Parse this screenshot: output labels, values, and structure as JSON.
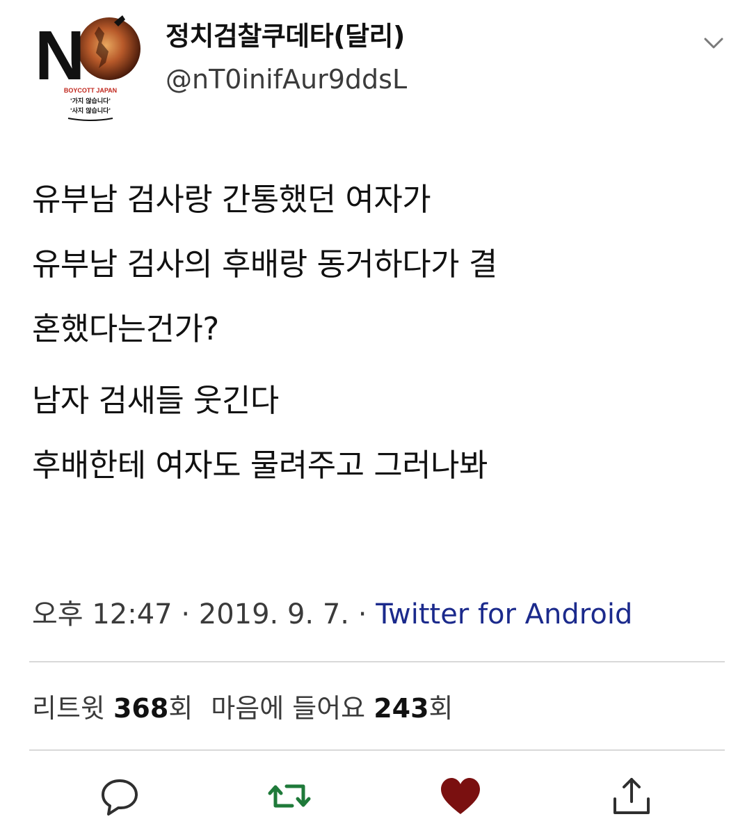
{
  "tweet": {
    "author": {
      "display_name": "정치검찰쿠데타(달리)",
      "handle": "@nT0inifAur9ddsL",
      "avatar": {
        "big_text": "N",
        "caption_line1": "BOYCOTT JAPAN",
        "caption_line2": "'가지 않습니다'",
        "caption_line3": "'사지 않습니다'"
      }
    },
    "menu_icon": "chevron-down-icon",
    "body": {
      "paragraph1": [
        "유부남 검사랑 간통했던 여자가",
        "유부남 검사의 후배랑 동거하다가 결",
        "혼했다는건가?"
      ],
      "paragraph2": [
        "남자 검새들 웃긴다",
        "후배한테 여자도 물려주고 그러나봐"
      ]
    },
    "meta": {
      "time": "오후 12:47",
      "separator": "·",
      "date": "2019. 9. 7.",
      "source": "Twitter for Android"
    },
    "stats": {
      "retweets_label": "리트윗",
      "retweets_count": "368",
      "retweets_unit": "회",
      "likes_label": "마음에 들어요",
      "likes_count": "243",
      "likes_unit": "회"
    },
    "actions": [
      {
        "name": "reply",
        "icon": "reply-bubble-icon"
      },
      {
        "name": "retweet",
        "icon": "retweet-arrows-icon",
        "active": true
      },
      {
        "name": "like",
        "icon": "heart-icon",
        "active": true
      },
      {
        "name": "share",
        "icon": "share-upload-icon"
      }
    ]
  },
  "colors": {
    "text": "#111111",
    "secondary_text": "#3b3b3b",
    "link": "#1b2a8c",
    "retweet_active": "#1f7a3a",
    "like_active": "#7a1010",
    "divider": "#d8d8d8"
  }
}
